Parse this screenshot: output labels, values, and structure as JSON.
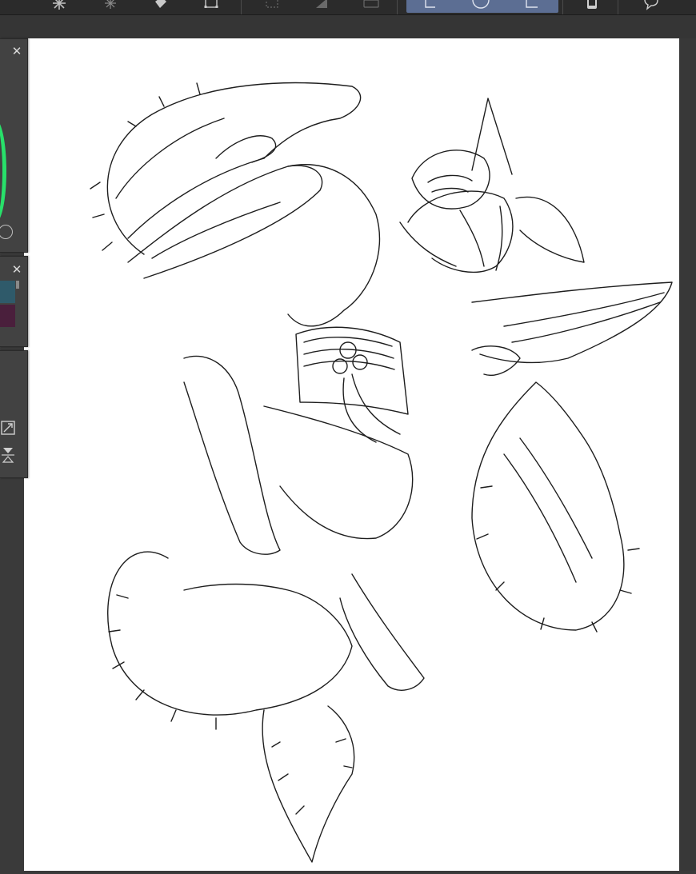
{
  "app": {
    "toolbar_icons": [
      "sparkle-icon",
      "burst-icon",
      "eraser-fill-icon",
      "transform-box-icon",
      "dotted-select-icon",
      "fill-shape-icon",
      "keyboard-icon",
      "lasso-icon",
      "circle-select-icon",
      "rectangle-select-icon",
      "phone-icon",
      "chat-bubble-icon"
    ],
    "active_group_color": "#5c6e93"
  },
  "panels": {
    "color_wheel": {
      "accent": "#28e06a"
    },
    "color_set": {
      "swatches": [
        "#2f5a6a",
        "#4a1f3c"
      ]
    },
    "navigator": {
      "icons": [
        "fit-window-icon",
        "flip-vertical-icon"
      ]
    }
  },
  "canvas": {
    "background": "#ffffff",
    "artwork": "line-art-illustration"
  }
}
